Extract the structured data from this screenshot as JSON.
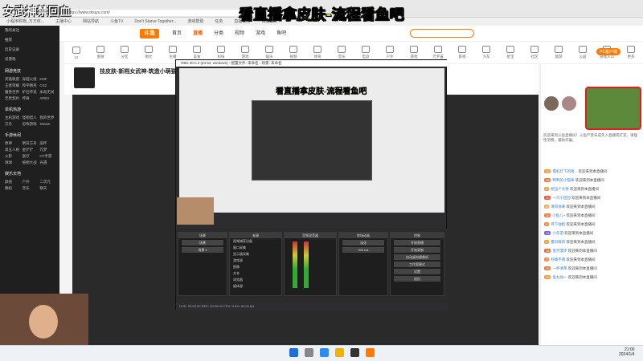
{
  "overlay": {
    "title": "看直播拿皮肤-流程看鱼吧",
    "streamer": "女武神禁回血"
  },
  "browser": {
    "url": "https://www.douyu.com/",
    "bookmarks": [
      "小程序购物_方方体...",
      "主播中心",
      "网站导航",
      "斗鱼TV",
      "Don't Starve Together...",
      "游戏帮助",
      "任务",
      "直播视频",
      "百度翻译"
    ],
    "nav": {
      "logo": "斗鱼",
      "links": [
        "首页",
        "直播",
        "分类",
        "视频",
        "游戏",
        "鱼吧"
      ],
      "active": "直播"
    },
    "categories": [
      "12",
      "金融",
      "分区",
      "图文",
      "主播",
      "美食",
      "科技",
      "游戏",
      "娱乐",
      "视频",
      "体育",
      "音乐",
      "电竞",
      "户外",
      "游戏",
      "元宇宙",
      "影视",
      "汽车",
      "星宝",
      "社区",
      "旅游",
      "公益",
      "游戏入口",
      "更多"
    ]
  },
  "sidebar": {
    "top": [
      "我的关注",
      "推荐",
      "历史记录",
      "云游戏"
    ],
    "sections": [
      {
        "title": "网游竞技",
        "items": [
          "英雄联盟",
          "穿越火线",
          "DNF",
          "王者荣耀",
          "和平精英",
          "CS2",
          "魔兽世界",
          "炉石传说",
          "永劫无间",
          "无畏契约",
          "传奇",
          "APEX"
        ]
      },
      {
        "title": "单机热游",
        "items": [
          "主机游戏",
          "怪物猎人",
          "我的世界",
          "方舟",
          "恐怖游戏",
          "Steam"
        ]
      },
      {
        "title": "手游休闲",
        "items": [
          "原神",
          "明日方舟",
          "崩坏",
          "第五人格",
          "金铲铲",
          "元梦",
          "火影",
          "蛋仔",
          "CF手游",
          "球球",
          "植物大战",
          "光遇"
        ]
      },
      {
        "title": "娱乐天地",
        "items": [
          "颜值",
          "户外",
          "二次元",
          "舞蹈",
          "音乐",
          "聊天"
        ]
      }
    ]
  },
  "room": {
    "title": "技皮肤-新档女武神-筑造小萌猫",
    "follow": "关注",
    "pc_btn": "PC客户端"
  },
  "obs": {
    "title": "OBS 30.0.2 (64-bit, windows) - 配置文件: 未命名 - 场景: 未命名",
    "nested_title": "看直播拿皮肤-流程看鱼吧",
    "docks": {
      "scenes": {
        "header": "场景",
        "items": [
          "场景",
          "场景 2"
        ]
      },
      "sources": {
        "header": "来源",
        "items": [
          "视频捕获设备",
          "窗口采集",
          "显示器采集",
          "游戏源",
          "图像",
          "文本",
          "浏览器",
          "媒体源"
        ]
      },
      "mixer": {
        "header": "音频混音器",
        "channels": [
          "桌面音频",
          "麦克风/Aux"
        ]
      },
      "transitions": {
        "header": "转场动画",
        "mode": "淡化",
        "duration": "300 ms"
      },
      "controls": {
        "header": "控制",
        "buttons": [
          "开始直播",
          "开始录制",
          "启动虚拟摄像机",
          "工作室模式",
          "设置",
          "退出"
        ]
      }
    },
    "status": "LIVE: 00:00:00   REC: 00:00:00   CPU: 0.6%, 60.00 fps"
  },
  "chat": {
    "notice": "欢迎来到斗鱼直播间！斗鱼严禁未成年人直播或打赏。请理性消费，谨防诈骗。",
    "lines": [
      {
        "badge": "12",
        "color": "#ff9a2e",
        "user": "霓虹灯下的哈...",
        "text": "欢迎来到本直播间"
      },
      {
        "badge": "15",
        "color": "#f07a3c",
        "user": "鸭鸭的小猫咪",
        "text": "欢迎来到本直播间"
      },
      {
        "badge": "8",
        "color": "#f59b42",
        "user": "想当个大佬",
        "text": "欢迎来到本直播间"
      },
      {
        "badge": "20",
        "color": "#e8562a",
        "user": "一只小团团",
        "text": "欢迎来到本直播间"
      },
      {
        "badge": "6",
        "color": "#ffa94d",
        "user": "清风徐来",
        "text": "欢迎来到本直播间"
      },
      {
        "badge": "11",
        "color": "#ff7a3d",
        "user": "小鱼儿~",
        "text": "欢迎来到本直播间"
      },
      {
        "badge": "9",
        "color": "#f28c38",
        "user": "月下独酌",
        "text": "欢迎来到本直播间"
      },
      {
        "badge": "14",
        "color": "#7a5cff",
        "user": "少年游",
        "text": "欢迎来到本直播间"
      },
      {
        "badge": "5",
        "color": "#ff9a2e",
        "user": "夏日微风",
        "text": "欢迎来到本直播间"
      },
      {
        "badge": "18",
        "color": "#ea6a2c",
        "user": "星河漫步",
        "text": "欢迎来到本直播间"
      },
      {
        "badge": "7",
        "color": "#ff8b3d",
        "user": "柠檬不萌",
        "text": "欢迎来到本直播间"
      },
      {
        "badge": "10",
        "color": "#f07a3c",
        "user": "一杯清茶",
        "text": "欢迎来到本直播间"
      },
      {
        "badge": "13",
        "color": "#ff9a2e",
        "user": "鱼丸加一",
        "text": "欢迎来到本直播间"
      }
    ]
  },
  "taskbar": {
    "time": "21:00",
    "date": "2024/1/4"
  },
  "colors": {
    "brand": "#ff7a00",
    "highlight": "#e02020"
  }
}
